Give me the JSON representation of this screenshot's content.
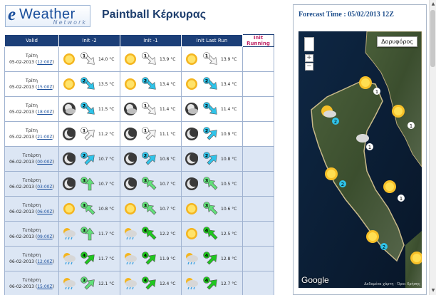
{
  "logo": {
    "letter": "e",
    "word": "Weather",
    "sub": "Network"
  },
  "page_title": "Paintball Κέρκυρας",
  "table": {
    "headers": [
      "Valid",
      "Init -2",
      "Init -1",
      "Init Last Run",
      "Init Running"
    ],
    "rows": [
      {
        "day": "Τρίτη",
        "date": "05-02-2013",
        "time": "12:00Z",
        "cells": [
          {
            "icon": "sunny",
            "wind": 1,
            "wind_color": "white",
            "dir": "se",
            "temp": "14.0 °C"
          },
          {
            "icon": "sunny",
            "wind": 1,
            "wind_color": "white",
            "dir": "se",
            "temp": "13.9 °C"
          },
          {
            "icon": "sunny",
            "wind": 1,
            "wind_color": "white",
            "dir": "se",
            "temp": "13.9 °C"
          }
        ]
      },
      {
        "day": "Τρίτη",
        "date": "05-02-2013",
        "time": "15:00Z",
        "cells": [
          {
            "icon": "sunny",
            "wind": 2,
            "wind_color": "cyan",
            "dir": "se",
            "temp": "13.5 °C"
          },
          {
            "icon": "sunny",
            "wind": 2,
            "wind_color": "cyan",
            "dir": "se",
            "temp": "13.4 °C"
          },
          {
            "icon": "sunny",
            "wind": 2,
            "wind_color": "cyan",
            "dir": "se",
            "temp": "13.4 °C"
          }
        ]
      },
      {
        "day": "Τρίτη",
        "date": "05-02-2013",
        "time": "18:00Z",
        "cells": [
          {
            "icon": "moon-cloud",
            "wind": 2,
            "wind_color": "cyan",
            "dir": "se",
            "temp": "11.5 °C"
          },
          {
            "icon": "moon-cloud",
            "wind": 1,
            "wind_color": "white",
            "dir": "se",
            "temp": "11.4 °C"
          },
          {
            "icon": "moon-cloud",
            "wind": 2,
            "wind_color": "cyan",
            "dir": "se",
            "temp": "11.4 °C"
          }
        ]
      },
      {
        "day": "Τρίτη",
        "date": "05-02-2013",
        "time": "21:00Z",
        "cells": [
          {
            "icon": "moon",
            "wind": 1,
            "wind_color": "white",
            "dir": "ne",
            "temp": "11.2 °C"
          },
          {
            "icon": "moon",
            "wind": 1,
            "wind_color": "white",
            "dir": "ne",
            "temp": "11.1 °C"
          },
          {
            "icon": "moon",
            "wind": 2,
            "wind_color": "cyan",
            "dir": "ne",
            "temp": "10.9 °C"
          }
        ]
      },
      {
        "day": "Τετάρτη",
        "date": "06-02-2013",
        "time": "00:00Z",
        "cells": [
          {
            "icon": "moon",
            "wind": 2,
            "wind_color": "cyan",
            "dir": "ne",
            "temp": "10.7 °C"
          },
          {
            "icon": "moon",
            "wind": 2,
            "wind_color": "cyan",
            "dir": "ne",
            "temp": "10.8 °C"
          },
          {
            "icon": "moon",
            "wind": 2,
            "wind_color": "cyan",
            "dir": "ne",
            "temp": "10.8 °C"
          }
        ]
      },
      {
        "day": "Τετάρτη",
        "date": "06-02-2013",
        "time": "03:00Z",
        "cells": [
          {
            "icon": "moon",
            "wind": 3,
            "wind_color": "lightgreen",
            "dir": "n",
            "temp": "10.7 °C"
          },
          {
            "icon": "moon",
            "wind": 3,
            "wind_color": "lightgreen",
            "dir": "nw",
            "temp": "10.7 °C"
          },
          {
            "icon": "moon",
            "wind": 3,
            "wind_color": "lightgreen",
            "dir": "nw",
            "temp": "10.5 °C"
          }
        ]
      },
      {
        "day": "Τετάρτη",
        "date": "06-02-2013",
        "time": "06:00Z",
        "cells": [
          {
            "icon": "sunny",
            "wind": 3,
            "wind_color": "lightgreen",
            "dir": "nw",
            "temp": "10.8 °C"
          },
          {
            "icon": "sunny",
            "wind": 3,
            "wind_color": "lightgreen",
            "dir": "nw",
            "temp": "10.7 °C"
          },
          {
            "icon": "sunny",
            "wind": 3,
            "wind_color": "lightgreen",
            "dir": "nw",
            "temp": "10.6 °C"
          }
        ]
      },
      {
        "day": "Τετάρτη",
        "date": "06-02-2013",
        "time": "09:00Z",
        "cells": [
          {
            "icon": "cloud-rain",
            "wind": 3,
            "wind_color": "lightgreen",
            "dir": "n",
            "temp": "11.7 °C"
          },
          {
            "icon": "cloud-rain",
            "wind": 4,
            "wind_color": "green",
            "dir": "nw",
            "temp": "12.2 °C"
          },
          {
            "icon": "sunny",
            "wind": 4,
            "wind_color": "green",
            "dir": "nw",
            "temp": "12.5 °C"
          }
        ]
      },
      {
        "day": "Τετάρτη",
        "date": "06-02-2013",
        "time": "12:00Z",
        "cells": [
          {
            "icon": "cloud-rain",
            "wind": 4,
            "wind_color": "green",
            "dir": "ne",
            "temp": "11.7 °C"
          },
          {
            "icon": "cloud-rain",
            "wind": 4,
            "wind_color": "green",
            "dir": "ne",
            "temp": "11.9 °C"
          },
          {
            "icon": "cloud-rain",
            "wind": 4,
            "wind_color": "green",
            "dir": "ne",
            "temp": "12.8 °C"
          }
        ]
      },
      {
        "day": "Τετάρτη",
        "date": "06-02-2013",
        "time": "15:00Z",
        "cells": [
          {
            "icon": "cloud-rain",
            "wind": 3,
            "wind_color": "lightgreen",
            "dir": "ne",
            "temp": "12.1 °C"
          },
          {
            "icon": "cloud-rain",
            "wind": 4,
            "wind_color": "green",
            "dir": "ne",
            "temp": "12.4 °C"
          },
          {
            "icon": "cloud-rain",
            "wind": 4,
            "wind_color": "green",
            "dir": "ne",
            "temp": "12.7 °C"
          }
        ]
      }
    ]
  },
  "map": {
    "forecast_time": "Forecast Time : 05/02/2013 12Z",
    "satellite_button": "Δορυφόρος",
    "zoom_in": "+",
    "zoom_out": "−",
    "google": "Google",
    "attribution": "Δεδομένα χάρτη · Όροι Χρήσης"
  },
  "colors": {
    "header_bg": "#1c3f78",
    "running_text": "#c02a6a",
    "alt_row": "#dce6f4",
    "link": "#1a4f9c",
    "wind_white": "#f4f4f4",
    "wind_cyan": "#2fc4ea",
    "wind_lightgreen": "#62e07a",
    "wind_green": "#1fc81f"
  }
}
